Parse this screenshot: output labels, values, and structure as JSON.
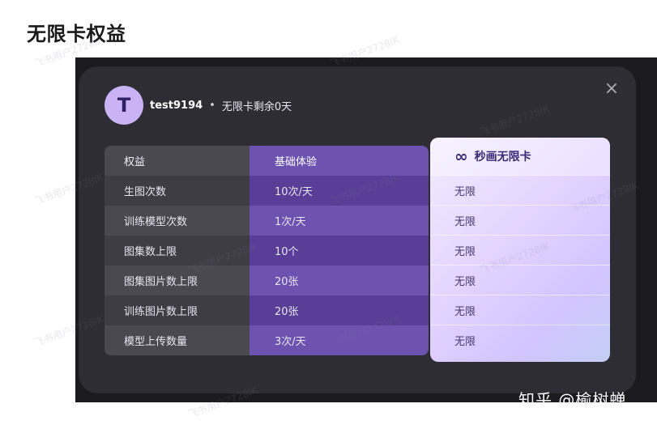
{
  "page_heading": "无限卡权益",
  "watermark": "飞书用户2728IK",
  "user": {
    "avatar_letter": "T",
    "name": "test9194",
    "separator": "•",
    "status": "无限卡剩余0天"
  },
  "close_icon": "×",
  "table": {
    "header": {
      "benefit": "权益",
      "basic": "基础体验"
    },
    "rows": [
      {
        "benefit": "生图次数",
        "basic": "10次/天",
        "premium": "无限"
      },
      {
        "benefit": "训练模型次数",
        "basic": "1次/天",
        "premium": "无限"
      },
      {
        "benefit": "图集数上限",
        "basic": "10个",
        "premium": "无限"
      },
      {
        "benefit": "图集图片数上限",
        "basic": "20张",
        "premium": "无限"
      },
      {
        "benefit": "训练图片数上限",
        "basic": "20张",
        "premium": "无限"
      },
      {
        "benefit": "模型上传数量",
        "basic": "3次/天",
        "premium": "无限"
      }
    ]
  },
  "premium": {
    "icon": "infinity-icon",
    "label": "秒画无限卡"
  },
  "brand_watermark": "知乎 @榆树蝉",
  "colors": {
    "accent_purple": "#6d52b0",
    "modal_bg": "#2e2d33",
    "avatar_bg": "#c9b3f5"
  }
}
